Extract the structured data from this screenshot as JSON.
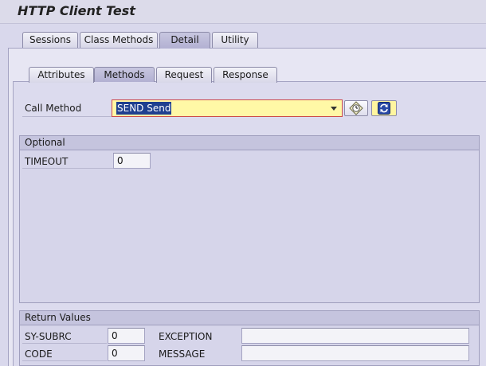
{
  "title": "HTTP Client Test",
  "outer_tabs": [
    {
      "label": "Sessions",
      "active": false
    },
    {
      "label": "Class Methods",
      "active": false
    },
    {
      "label": "Detail",
      "active": true
    },
    {
      "label": "Utility",
      "active": false
    }
  ],
  "inner_tabs": [
    {
      "label": "Attributes",
      "active": false
    },
    {
      "label": "Methods",
      "active": true
    },
    {
      "label": "Request",
      "active": false
    },
    {
      "label": "Response",
      "active": false
    }
  ],
  "call_method": {
    "label": "Call Method",
    "value": "SEND Send"
  },
  "optional": {
    "header": "Optional",
    "timeout_label": "TIMEOUT",
    "timeout_value": "0"
  },
  "return_values": {
    "header": "Return Values",
    "sy_subrc_label": "SY-SUBRC",
    "sy_subrc_value": "0",
    "code_label": "CODE",
    "code_value": "0",
    "exception_label": "EXCEPTION",
    "exception_value": "",
    "message_label": "MESSAGE",
    "message_value": ""
  },
  "icons": {
    "execute": "clock-execute-icon",
    "refresh": "refresh-icon"
  },
  "colors": {
    "highlight_field": "#fff8a6",
    "selection": "#1f3f8f",
    "required_marker": "#cc4a4a"
  }
}
